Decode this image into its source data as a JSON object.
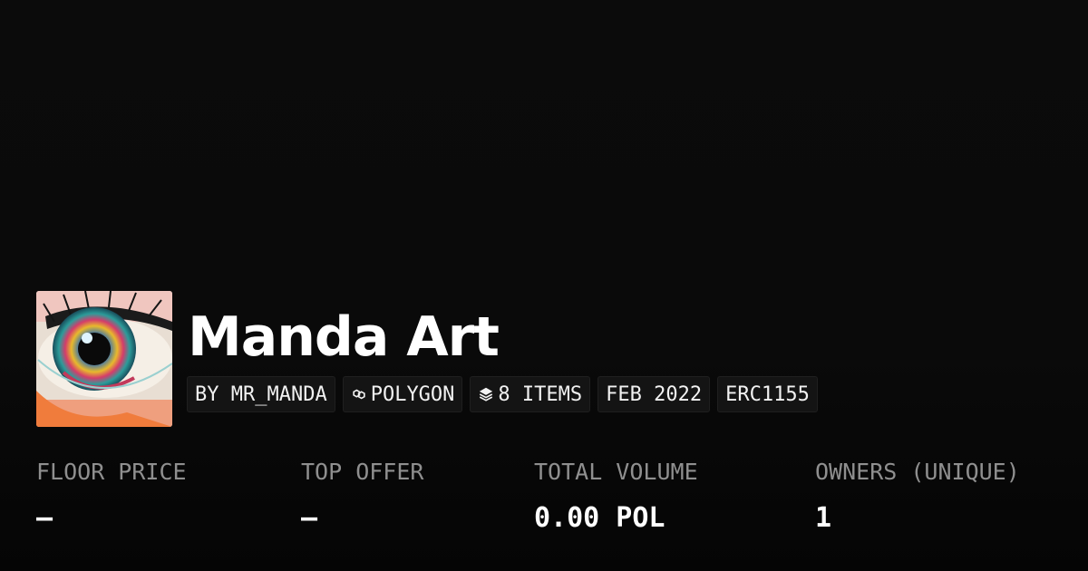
{
  "collection": {
    "title": "Manda Art",
    "creator": "BY MR_MANDA",
    "chain": "POLYGON",
    "items": "8 ITEMS",
    "date": "FEB 2022",
    "standard": "ERC1155",
    "avatar_icon": "eye-painting-image",
    "chain_icon": "polygon-chain-icon",
    "items_icon": "layers-icon"
  },
  "stats": [
    {
      "label": "FLOOR PRICE",
      "value": "–"
    },
    {
      "label": "TOP OFFER",
      "value": "–"
    },
    {
      "label": "TOTAL VOLUME",
      "value": "0.00 POL"
    },
    {
      "label": "OWNERS (UNIQUE)",
      "value": "1"
    }
  ],
  "colors": {
    "background": "#0b0b0b",
    "badge_background": "#141414",
    "label_gray": "#8f8f8f",
    "text_white": "#ffffff"
  }
}
